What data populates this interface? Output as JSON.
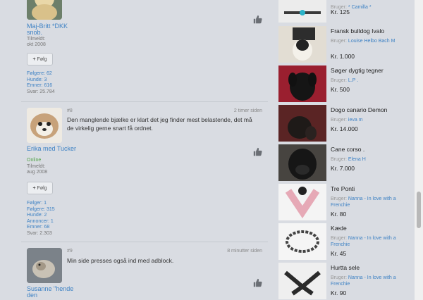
{
  "posts": [
    {
      "user": "Maj-Britt *DKK snob.",
      "member_label": "Tilmeldt:",
      "member_since": "okt 2008",
      "follow_label": "Følg",
      "stats": [
        "Følgere: 62",
        "Hunde: 3",
        "Emner: 616",
        "Svar: 25.784"
      ]
    },
    {
      "number": "#8",
      "time": "2 timer siden",
      "user": "Erika med Tucker",
      "status": "Online",
      "member_label": "Tilmeldt:",
      "member_since": "aug 2008",
      "follow_label": "Følg",
      "text": "Den manglende bjælke er klart det jeg finder mest belastende, det må de virkelig gerne snart få ordnet.",
      "stats": [
        "Følger: 1",
        "Følgere: 315",
        "Hunde: 2",
        "Annoncer: 1",
        "Emner: 68",
        "Svar: 2.303"
      ]
    },
    {
      "number": "#9",
      "time": "8 minutter siden",
      "user": "Susanne \"hende den",
      "text": "Min side presses også ind med adblock."
    }
  ],
  "sidebar": {
    "user_label": "Bruger:",
    "items": [
      {
        "title": "",
        "user": "* Camilla *",
        "price": "Kr. 125"
      },
      {
        "title": "Fransk bulldog Ivalo",
        "user": "Louise Helbo Bach M",
        "price": "Kr. 1.000"
      },
      {
        "title": "Søger dygtig tegner",
        "user": "L.P .",
        "price": "Kr. 500"
      },
      {
        "title": "Dogo canario Demon",
        "user": "ieva m",
        "price": "Kr. 14.000"
      },
      {
        "title": "Cane corso .",
        "user": "Elena H",
        "price": "Kr. 7.000"
      },
      {
        "title": "Tre Ponti",
        "user": "Nanna - In love with a Frenchie",
        "price": "Kr. 80"
      },
      {
        "title": "Kæde",
        "user": "Nanna - In love with a Frenchie",
        "price": "Kr. 45"
      },
      {
        "title": "Hurtta sele",
        "user": "Nanna - In love with a Frenchie",
        "price": "Kr. 90"
      }
    ]
  },
  "colors": {
    "link": "#3e82c4",
    "online": "#52a447",
    "background": "#d9dce2"
  }
}
